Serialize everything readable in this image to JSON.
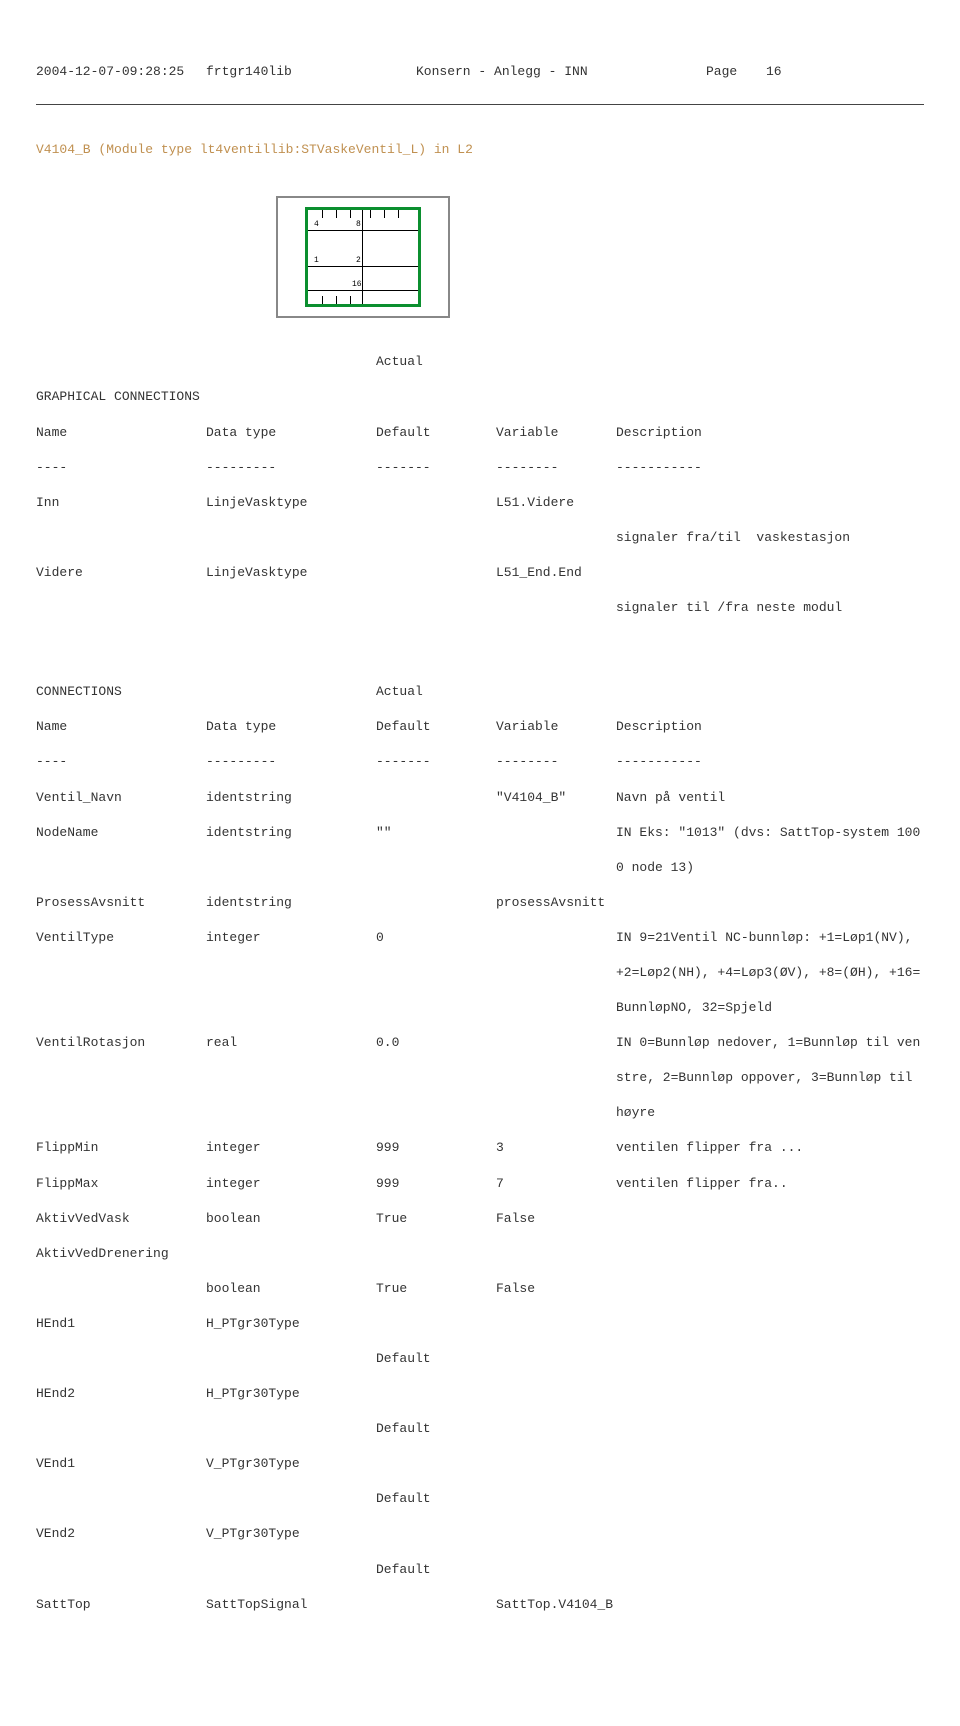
{
  "header": {
    "ts": "2004-12-07-09:28:25",
    "lib": "frtgr140lib",
    "where": "Konsern - Anlegg - INN",
    "pagelbl": "Page",
    "pageno": "16"
  },
  "title": "V4104_B (Module type lt4ventillib:STVaskeVentil_L) in L2",
  "diag": {
    "n4": "4",
    "n8": "8",
    "n1": "1",
    "n2": "2",
    "n16": "16"
  },
  "gc": {
    "h": "GRAPHICAL CONNECTIONS",
    "actual": "Actual",
    "cols": {
      "name": "Name",
      "dtype": "Data type",
      "def": "Default",
      "var": "Variable",
      "desc": "Description"
    },
    "dash": {
      "name": "----",
      "dtype": "---------",
      "def": "-------",
      "var": "--------",
      "desc": "-----------"
    },
    "r1": {
      "name": "Inn",
      "dtype": "LinjeVasktype",
      "var": "L51.Videre",
      "desc": "signaler fra/til  vaskestasjon"
    },
    "r2": {
      "name": "Videre",
      "dtype": "LinjeVasktype",
      "var": "L51_End.End",
      "desc": "signaler til /fra neste modul"
    }
  },
  "cn": {
    "h": "CONNECTIONS",
    "actual": "Actual",
    "cols": {
      "name": "Name",
      "dtype": "Data type",
      "def": "Default",
      "var": "Variable",
      "desc": "Description"
    },
    "dash": {
      "name": "----",
      "dtype": "---------",
      "def": "-------",
      "var": "--------",
      "desc": "-----------"
    },
    "r": {
      "vent": {
        "name": "Ventil_Navn",
        "dtype": "identstring",
        "var": "\"V4104_B\"",
        "desc": "Navn på ventil"
      },
      "node": {
        "name": "NodeName",
        "dtype": "identstring",
        "def": "\"\"",
        "desc1": "IN Eks: \"1013\" (dvs: SattTop-system 100",
        "desc2": "0 node 13)"
      },
      "pros": {
        "name": "ProsessAvsnitt",
        "dtype": "identstring",
        "var": "prosessAvsnitt"
      },
      "vtype": {
        "name": "VentilType",
        "dtype": "integer",
        "def": "0",
        "d1": "IN 9=21Ventil NC-bunnløp: +1=Løp1(NV),",
        "d2": "+2=Løp2(NH), +4=Løp3(ØV), +8=(ØH), +16=",
        "d3": "BunnløpNO, 32=Spjeld"
      },
      "vrot": {
        "name": "VentilRotasjon",
        "dtype": "real",
        "def": "0.0",
        "d1": "IN 0=Bunnløp nedover, 1=Bunnløp til ven",
        "d2": "stre, 2=Bunnløp oppover, 3=Bunnløp til",
        "d3": "høyre"
      },
      "fmin": {
        "name": "FlippMin",
        "dtype": "integer",
        "def": "999",
        "var": "3",
        "desc": "ventilen flipper fra ..."
      },
      "fmax": {
        "name": "FlippMax",
        "dtype": "integer",
        "def": "999",
        "var": "7",
        "desc": "ventilen flipper fra.."
      },
      "avvask": {
        "name": "AktivVedVask",
        "dtype": "boolean",
        "def": "True",
        "var": "False"
      },
      "avdren": {
        "name": "AktivVedDrenering",
        "dtype": "boolean",
        "def": "True",
        "var": "False"
      },
      "hend1": {
        "name": "HEnd1",
        "dtype": "H_PTgr30Type",
        "def": "Default"
      },
      "hend2": {
        "name": "HEnd2",
        "dtype": "H_PTgr30Type",
        "def": "Default"
      },
      "vend1": {
        "name": "VEnd1",
        "dtype": "V_PTgr30Type",
        "def": "Default"
      },
      "vend2": {
        "name": "VEnd2",
        "dtype": "V_PTgr30Type",
        "def": "Default"
      },
      "satt": {
        "name": "SattTop",
        "dtype": "SattTopSignal",
        "var": "SattTop.V4104_B"
      }
    }
  }
}
